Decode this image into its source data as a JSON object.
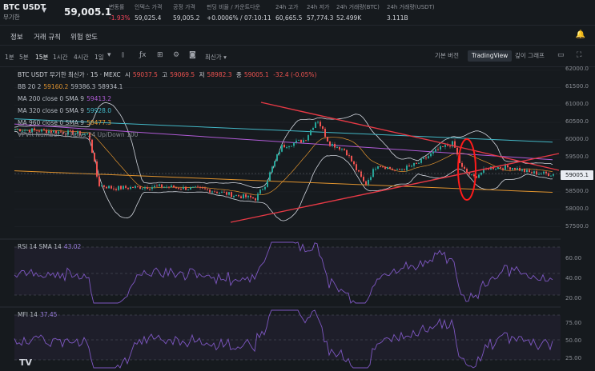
{
  "header": {
    "symbol": "BTC USDT",
    "contract_type": "무기한",
    "price": "59,005.1",
    "stats": [
      {
        "label": "변동률",
        "value": "-1.93%",
        "color": "red"
      },
      {
        "label": "인덱스 가격",
        "value": "59,025.4"
      },
      {
        "label": "공정 가격",
        "value": "59,005.2"
      },
      {
        "label": "펀딩 비율 / 카운트다운",
        "value": "+0.0006% / 07:10:11"
      },
      {
        "label": "24h 고가",
        "value": "60,665.5"
      },
      {
        "label": "24h 저가",
        "value": "57,774.3"
      },
      {
        "label": "24h 거래량(BTC)",
        "value": "52.499K"
      },
      {
        "label": "24h 거래량(USDT)",
        "value": "3.111B"
      }
    ]
  },
  "tabs": [
    "정보",
    "거래 규칙",
    "위험 한도"
  ],
  "toolbar": {
    "intervals": [
      "1분",
      "5분",
      "15분",
      "1시간",
      "4시간",
      "1일"
    ],
    "active_interval": "15분",
    "latest_price_label": "최신가",
    "views": [
      "기본 버전",
      "TradingView",
      "깊이 그래프"
    ],
    "selected_view": "TradingView"
  },
  "legend": {
    "main_title": "BTC USDT 무기한 최신가 · 15 · MEXC",
    "ohlc": {
      "o_label": "시",
      "o": "59037.5",
      "h_label": "고",
      "h": "59069.5",
      "l_label": "저",
      "l": "58982.3",
      "c_label": "종",
      "c": "59005.1",
      "change": "-32.4 (-0.05%)"
    },
    "bb": {
      "label": "BB 20 2",
      "v1": "59160.2",
      "v2": "59386.3",
      "v3": "58934.1"
    },
    "ma200": {
      "label": "MA 200 close 0 SMA 9",
      "value": "59413.2"
    },
    "ma320": {
      "label": "MA 320 close 0 SMA 9",
      "value": "59928.0"
    },
    "ma960": {
      "label": "MA 960 close 0 SMA 9",
      "value": "58477.3"
    },
    "vpvr": "VPVR Number Of Rows 24 Up/Down 100"
  },
  "price_axis": [
    "62000.0",
    "61500.0",
    "61000.0",
    "60500.0",
    "60000.0",
    "59500.0",
    "59000.0",
    "58500.0",
    "58000.0",
    "57500.0"
  ],
  "current_price_tag": "59005.1",
  "rsi": {
    "label": "RSI 14 SMA 14",
    "value": "43.02",
    "axis": [
      "60.00",
      "40.00",
      "20.00"
    ]
  },
  "mfi": {
    "label": "MFI 14",
    "value": "37.45",
    "axis": [
      "75.00",
      "50.00",
      "25.00"
    ]
  },
  "colors": {
    "up": "#26a69a",
    "down": "#ef5350",
    "ma200": "#b05bd6",
    "ma320": "#43b8c7",
    "ma960": "#e0932e",
    "bb": "#d0d4dc",
    "indicator": "#7e57c2"
  }
}
